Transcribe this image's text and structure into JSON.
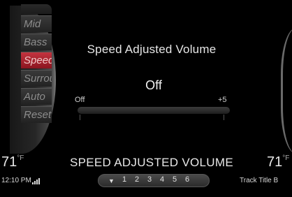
{
  "menu": {
    "items": [
      {
        "label": "Mid",
        "active": false
      },
      {
        "label": "Bass",
        "active": false
      },
      {
        "label": "Speed",
        "active": true
      },
      {
        "label": "Surround",
        "active": false
      },
      {
        "label": "Auto",
        "active": false
      },
      {
        "label": "Reset",
        "active": false
      }
    ]
  },
  "panel": {
    "title": "Speed Adjusted Volume",
    "value": "Off",
    "min_label": "Off",
    "max_label": "+5",
    "level_fraction": 0.0
  },
  "status": {
    "temp_left": "71",
    "temp_right": "71",
    "degree_symbol": "°F",
    "title": "SPEED ADJUSTED VOLUME",
    "clock": "12:10 PM",
    "track": "Track Title B"
  },
  "presets": {
    "arrow_icon": "triangle-down-icon",
    "items": [
      "1",
      "2",
      "3",
      "4",
      "5",
      "6"
    ]
  },
  "colors": {
    "accent": "#b8252f"
  }
}
